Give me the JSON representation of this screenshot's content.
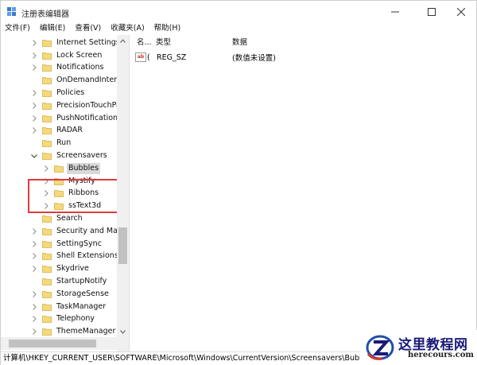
{
  "window": {
    "title": "注册表编辑器"
  },
  "menu": [
    {
      "label": "文件(F)"
    },
    {
      "label": "编辑(E)"
    },
    {
      "label": "查看(V)"
    },
    {
      "label": "收藏夹(A)"
    },
    {
      "label": "帮助(H)"
    }
  ],
  "tree": [
    {
      "label": "Internet Settings",
      "expander": "collapsed",
      "indent": 1,
      "selected": false
    },
    {
      "label": "Lock Screen",
      "expander": "collapsed",
      "indent": 1,
      "selected": false
    },
    {
      "label": "Notifications",
      "expander": "collapsed",
      "indent": 1,
      "selected": false
    },
    {
      "label": "OnDemandInterf",
      "expander": "none",
      "indent": 1,
      "selected": false
    },
    {
      "label": "Policies",
      "expander": "collapsed",
      "indent": 1,
      "selected": false
    },
    {
      "label": "PrecisionTouchPa",
      "expander": "collapsed",
      "indent": 1,
      "selected": false
    },
    {
      "label": "PushNotifications",
      "expander": "collapsed",
      "indent": 1,
      "selected": false
    },
    {
      "label": "RADAR",
      "expander": "collapsed",
      "indent": 1,
      "selected": false
    },
    {
      "label": "Run",
      "expander": "none",
      "indent": 1,
      "selected": false
    },
    {
      "label": "Screensavers",
      "expander": "expanded",
      "indent": 1,
      "selected": false
    },
    {
      "label": "Bubbles",
      "expander": "collapsed",
      "indent": 2,
      "selected": true
    },
    {
      "label": "Mystify",
      "expander": "collapsed",
      "indent": 2,
      "selected": false
    },
    {
      "label": "Ribbons",
      "expander": "collapsed",
      "indent": 2,
      "selected": false
    },
    {
      "label": "ssText3d",
      "expander": "collapsed",
      "indent": 2,
      "selected": false
    },
    {
      "label": "Search",
      "expander": "none",
      "indent": 1,
      "selected": false
    },
    {
      "label": "Security and Mai",
      "expander": "collapsed",
      "indent": 1,
      "selected": false
    },
    {
      "label": "SettingSync",
      "expander": "collapsed",
      "indent": 1,
      "selected": false
    },
    {
      "label": "Shell Extensions",
      "expander": "collapsed",
      "indent": 1,
      "selected": false
    },
    {
      "label": "Skydrive",
      "expander": "collapsed",
      "indent": 1,
      "selected": false
    },
    {
      "label": "StartupNotify",
      "expander": "none",
      "indent": 1,
      "selected": false
    },
    {
      "label": "StorageSense",
      "expander": "collapsed",
      "indent": 1,
      "selected": false
    },
    {
      "label": "TaskManager",
      "expander": "collapsed",
      "indent": 1,
      "selected": false
    },
    {
      "label": "Telephony",
      "expander": "collapsed",
      "indent": 1,
      "selected": false
    },
    {
      "label": "ThemeManager",
      "expander": "collapsed",
      "indent": 1,
      "selected": false
    }
  ],
  "values": {
    "headers": {
      "name": "名...",
      "type": "类型",
      "data": "数据"
    },
    "rows": [
      {
        "name": "(",
        "type": "REG_SZ",
        "data": "(数值未设置)",
        "icon": "string-value-icon"
      }
    ]
  },
  "status": {
    "path": "计算机\\HKEY_CURRENT_USER\\SOFTWARE\\Microsoft\\Windows\\CurrentVersion\\Screensavers\\Bubbles"
  },
  "watermark": {
    "title": "这里教程网",
    "url": "herecours.com"
  },
  "colors": {
    "highlight": "#e03b3b",
    "folder": "#f5d97a",
    "selection": "#d9d9d9"
  }
}
